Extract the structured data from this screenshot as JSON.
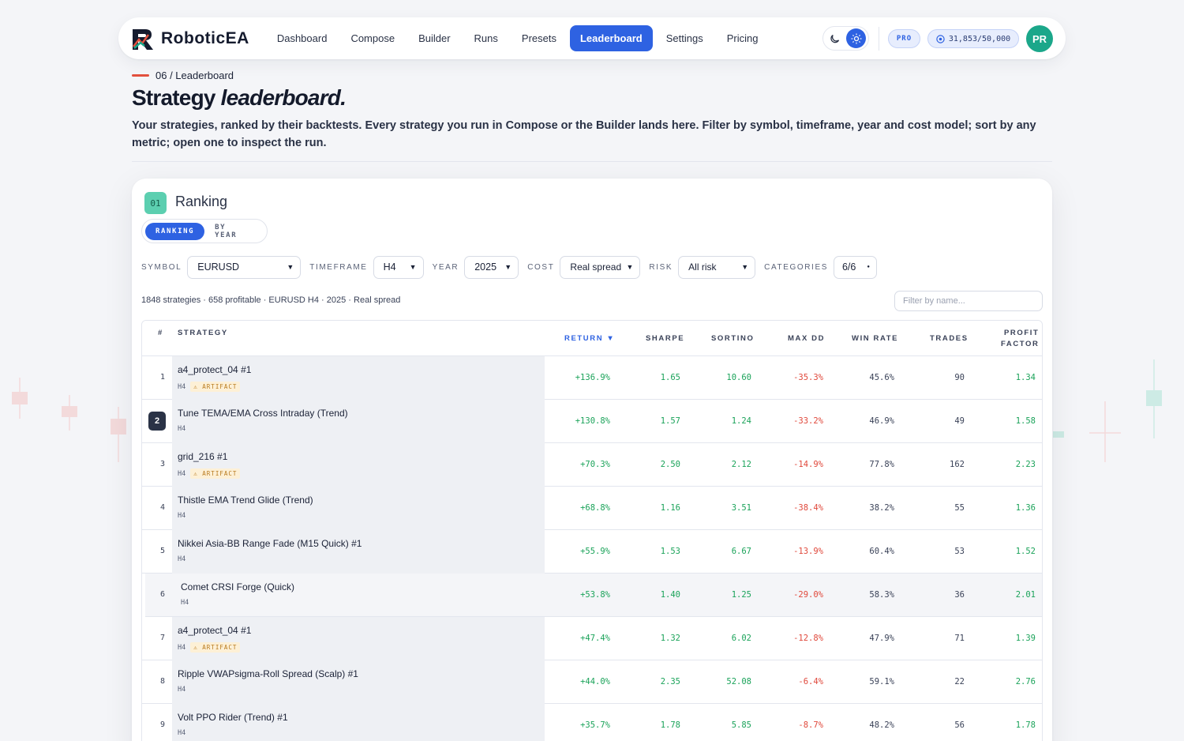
{
  "nav": {
    "logo_text": "RoboticEA",
    "links": [
      {
        "label": "Dashboard",
        "active": false
      },
      {
        "label": "Compose",
        "active": false
      },
      {
        "label": "Builder",
        "active": false
      },
      {
        "label": "Runs",
        "active": false
      },
      {
        "label": "Presets",
        "active": false
      },
      {
        "label": "Leaderboard",
        "active": true
      },
      {
        "label": "Settings",
        "active": false
      },
      {
        "label": "Pricing",
        "active": false
      }
    ],
    "plan_badge": "PRO",
    "credits": "31,853/50,000",
    "avatar_initials": "PR"
  },
  "header": {
    "breadcrumb": "06 / Leaderboard",
    "title_plain": "Strategy ",
    "title_italic": "leaderboard.",
    "description": "Your strategies, ranked by their backtests. Every strategy you run in Compose or the Builder lands here. Filter by symbol, timeframe, year and cost model; sort by any metric; open one to inspect the run."
  },
  "section": {
    "number": "01",
    "title": "Ranking",
    "tabs": [
      {
        "label": "RANKING",
        "active": true
      },
      {
        "label": "BY YEAR",
        "active": false
      }
    ]
  },
  "filters": {
    "symbol_label": "SYMBOL",
    "symbol_value": "EURUSD",
    "timeframe_label": "TIMEFRAME",
    "timeframe_value": "H4",
    "year_label": "YEAR",
    "year_value": "2025",
    "cost_label": "COST",
    "cost_value": "Real spread",
    "risk_label": "RISK",
    "risk_value": "All risk",
    "categories_label": "CATEGORIES",
    "categories_value": "6/6"
  },
  "summary": "1848 strategies · 658 profitable · EURUSD H4 · 2025 · Real spread",
  "name_filter_placeholder": "Filter by name...",
  "table": {
    "headers": {
      "rank": "#",
      "strategy": "STRATEGY",
      "return": "RETURN ▼",
      "sharpe": "SHARPE",
      "sortino": "SORTINO",
      "max_dd": "MAX DD",
      "win_rate": "WIN RATE",
      "trades": "TRADES",
      "profit_factor_1": "PROFIT",
      "profit_factor_2": "FACTOR"
    },
    "artifact_label": "⚠ ARTIFACT",
    "rows": [
      {
        "rank": "1",
        "name": "a4_protect_04 #1",
        "tf": "H4",
        "artifact": true,
        "ret": "+136.9%",
        "sharpe": "1.65",
        "sortino": "10.60",
        "dd": "-35.3%",
        "win": "45.6%",
        "trades": "90",
        "pf": "1.34"
      },
      {
        "rank": "2",
        "name": "Tune TEMA/EMA Cross Intraday (Trend)",
        "tf": "H4",
        "artifact": false,
        "ret": "+130.8%",
        "sharpe": "1.57",
        "sortino": "1.24",
        "dd": "-33.2%",
        "win": "46.9%",
        "trades": "49",
        "pf": "1.58"
      },
      {
        "rank": "3",
        "name": "grid_216 #1",
        "tf": "H4",
        "artifact": true,
        "ret": "+70.3%",
        "sharpe": "2.50",
        "sortino": "2.12",
        "dd": "-14.9%",
        "win": "77.8%",
        "trades": "162",
        "pf": "2.23"
      },
      {
        "rank": "4",
        "name": "Thistle EMA Trend Glide (Trend)",
        "tf": "H4",
        "artifact": false,
        "ret": "+68.8%",
        "sharpe": "1.16",
        "sortino": "3.51",
        "dd": "-38.4%",
        "win": "38.2%",
        "trades": "55",
        "pf": "1.36"
      },
      {
        "rank": "5",
        "name": "Nikkei Asia-BB Range Fade (M15 Quick) #1",
        "tf": "H4",
        "artifact": false,
        "ret": "+55.9%",
        "sharpe": "1.53",
        "sortino": "6.67",
        "dd": "-13.9%",
        "win": "60.4%",
        "trades": "53",
        "pf": "1.52"
      },
      {
        "rank": "6",
        "name": "Comet CRSI Forge (Quick)",
        "tf": "H4",
        "artifact": false,
        "ret": "+53.8%",
        "sharpe": "1.40",
        "sortino": "1.25",
        "dd": "-29.0%",
        "win": "58.3%",
        "trades": "36",
        "pf": "2.01"
      },
      {
        "rank": "7",
        "name": "a4_protect_04 #1",
        "tf": "H4",
        "artifact": true,
        "ret": "+47.4%",
        "sharpe": "1.32",
        "sortino": "6.02",
        "dd": "-12.8%",
        "win": "47.9%",
        "trades": "71",
        "pf": "1.39"
      },
      {
        "rank": "8",
        "name": "Ripple VWAPsigma-Roll Spread (Scalp) #1",
        "tf": "H4",
        "artifact": false,
        "ret": "+44.0%",
        "sharpe": "2.35",
        "sortino": "52.08",
        "dd": "-6.4%",
        "win": "59.1%",
        "trades": "22",
        "pf": "2.76"
      },
      {
        "rank": "9",
        "name": "Volt PPO Rider (Trend) #1",
        "tf": "H4",
        "artifact": false,
        "ret": "+35.7%",
        "sharpe": "1.78",
        "sortino": "5.85",
        "dd": "-8.7%",
        "win": "48.2%",
        "trades": "56",
        "pf": "1.78"
      }
    ]
  },
  "colors": {
    "accent": "#2e62e2",
    "positive": "#1ba35a",
    "negative": "#e0483b",
    "avatar": "#1ba78a",
    "section_badge": "#5ccfb0"
  }
}
